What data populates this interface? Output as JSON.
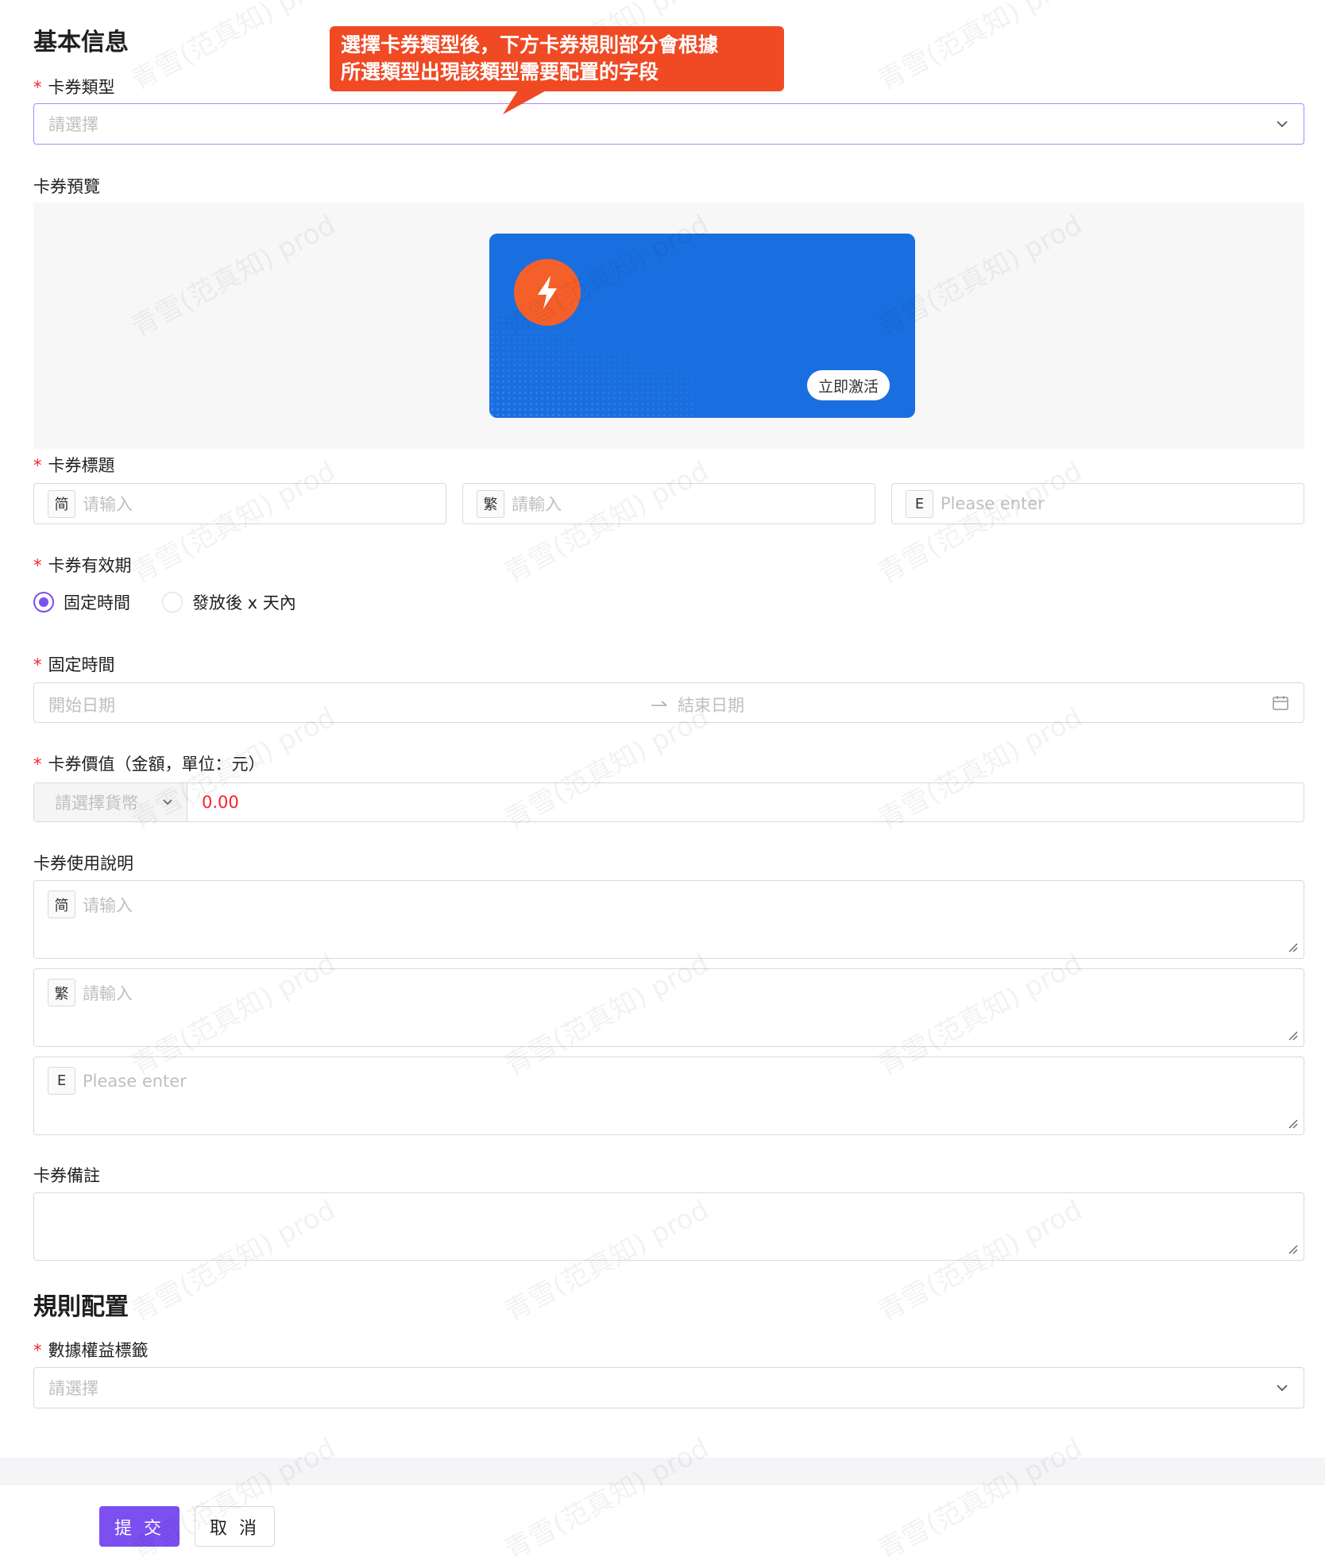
{
  "basic_info": {
    "section_title": "基本信息",
    "card_type": {
      "label": "卡券類型",
      "placeholder": "請選擇"
    },
    "preview": {
      "label": "卡券預覽",
      "activate_button": "立即激活"
    },
    "card_title": {
      "label": "卡券標題",
      "inputs": [
        {
          "tag": "简",
          "placeholder": "请输入"
        },
        {
          "tag": "繁",
          "placeholder": "請輸入"
        },
        {
          "tag": "E",
          "placeholder": "Please enter"
        }
      ]
    },
    "validity": {
      "label": "卡券有效期",
      "options": [
        "固定時間",
        "發放後 x 天內"
      ],
      "selected": "固定時間"
    },
    "fixed_time": {
      "label": "固定時間",
      "start_placeholder": "開始日期",
      "end_placeholder": "結束日期"
    },
    "value": {
      "label": "卡券價值（金額，單位：元）",
      "currency_placeholder": "請選擇貨幣",
      "amount": "0.00"
    },
    "usage": {
      "label": "卡券使用說明",
      "inputs": [
        {
          "tag": "简",
          "placeholder": "请输入"
        },
        {
          "tag": "繁",
          "placeholder": "請輸入"
        },
        {
          "tag": "E",
          "placeholder": "Please enter"
        }
      ]
    },
    "remark": {
      "label": "卡券備註"
    }
  },
  "rules": {
    "section_title": "規則配置",
    "data_tag": {
      "label": "數據權益標籤",
      "placeholder": "請選擇"
    }
  },
  "footer": {
    "submit": "提 交",
    "cancel": "取 消"
  },
  "callout": {
    "line1": "選擇卡券類型後，下方卡券規則部分會根據",
    "line2": "所選類型出現該類型需要配置的字段"
  },
  "watermark": "青雪(范真知) prod",
  "colors": {
    "primary": "#7b4ff0",
    "required": "#f5222d",
    "card_bg": "#1a6fe0",
    "logo_bg": "#f5602a",
    "callout_bg": "#ef4a24"
  },
  "icons": [
    "chevron-down-icon",
    "lightning-icon",
    "arrow-right-icon",
    "calendar-icon",
    "resize-grip-icon"
  ]
}
